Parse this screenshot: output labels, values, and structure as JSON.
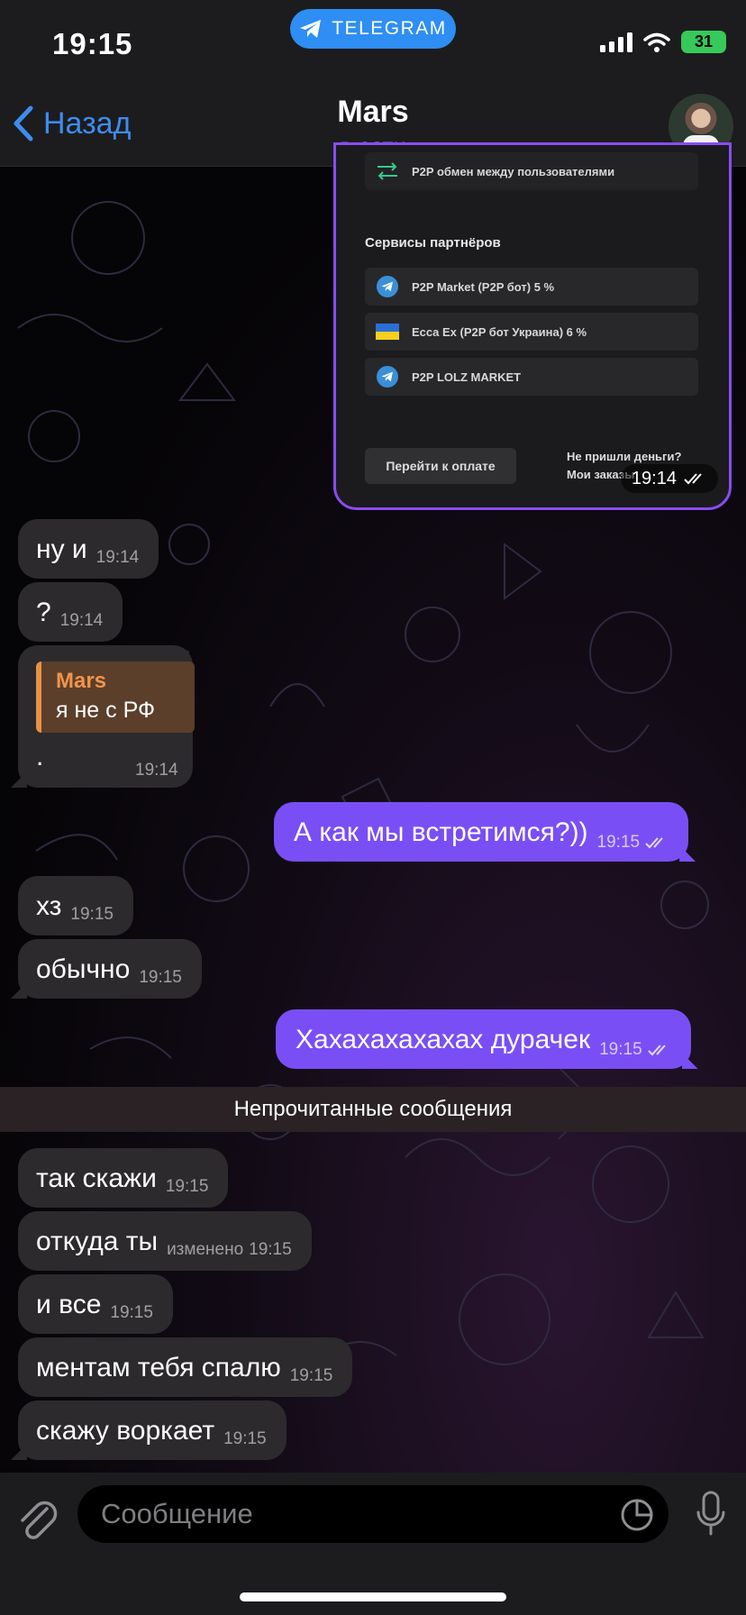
{
  "status_bar": {
    "time": "19:15",
    "app_pill": "TELEGRAM",
    "battery": "31"
  },
  "header": {
    "back_label": "Назад",
    "contact_name": "Mars",
    "status": "в сети"
  },
  "forwarded_screenshot": {
    "top_item": "P2P обмен между пользователями",
    "section_title": "Сервисы партнёров",
    "items": [
      "P2P Market (P2P бот) 5 %",
      "Ecca Ex (P2P бот Украина) 6 %",
      "P2P LOLZ MARKET"
    ],
    "pay_button": "Перейти к оплате",
    "no_money_line1": "Не пришли деньги?",
    "no_money_line2": "Мои заказы",
    "time": "19:14"
  },
  "messages": [
    {
      "text": "ну и",
      "time": "19:14"
    },
    {
      "text": "?",
      "time": "19:14"
    },
    {
      "reply_name": "Mars",
      "reply_text": "я не с РФ",
      "text": ".",
      "time": "19:14"
    },
    {
      "text": "А как мы встретимся?))",
      "time": "19:15"
    },
    {
      "text": "хз",
      "time": "19:15"
    },
    {
      "text": "обычно",
      "time": "19:15"
    },
    {
      "text": "Хахахахахахах дурачек",
      "time": "19:15"
    },
    {
      "text": "так скажи",
      "time": "19:15"
    },
    {
      "text": "откуда ты",
      "edited": "изменено",
      "time": "19:15"
    },
    {
      "text": "и все",
      "time": "19:15"
    },
    {
      "text": "ментам тебя спалю",
      "time": "19:15"
    },
    {
      "text": "скажу воркает",
      "time": "19:15"
    }
  ],
  "unread_divider": "Непрочитанные сообщения",
  "composer": {
    "placeholder": "Сообщение"
  },
  "colors": {
    "outgoing": "#7a4ef5",
    "incoming": "#2c2a2d",
    "accent": "#3e8cf0"
  }
}
